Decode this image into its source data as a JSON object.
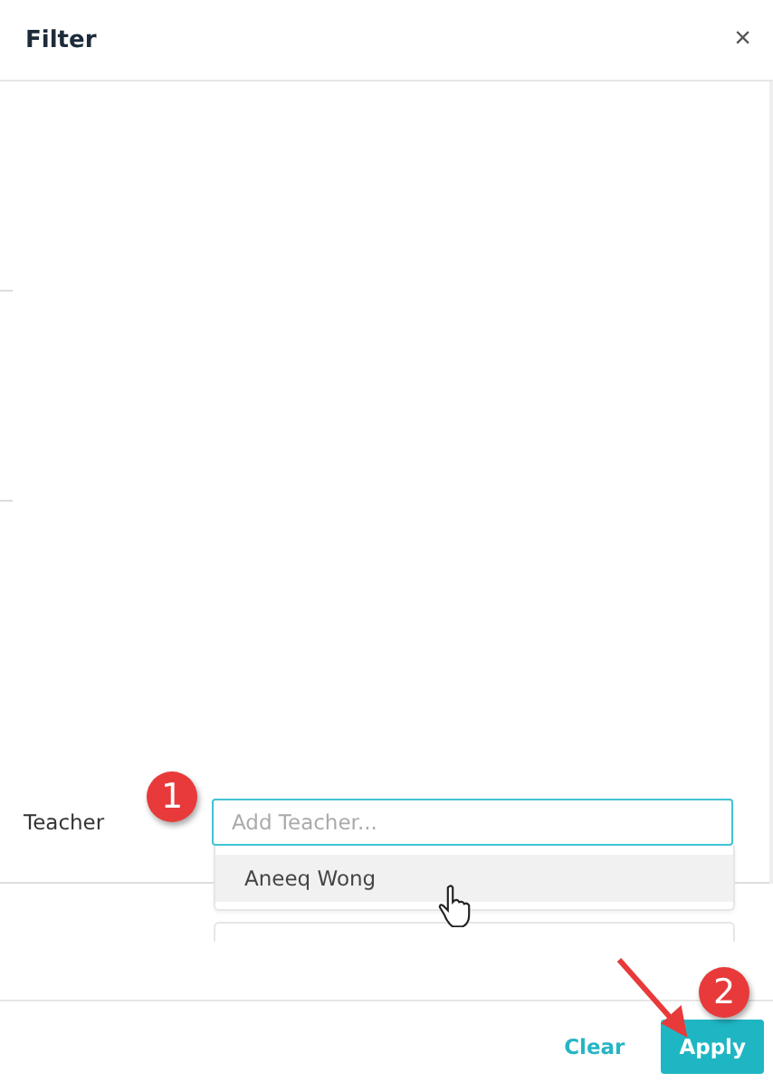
{
  "dialog": {
    "title": "Filter",
    "close": "×"
  },
  "teacher_field": {
    "label": "Teacher",
    "placeholder": "Add Teacher..."
  },
  "suggestions": [
    {
      "name": "Aneeq Wong",
      "selected": true
    }
  ],
  "annotations": [
    {
      "number": "1"
    },
    {
      "number": "2"
    }
  ],
  "buttons": [
    {
      "label": "Clear",
      "kind": "link"
    },
    {
      "label": "Apply",
      "kind": "primary"
    }
  ]
}
